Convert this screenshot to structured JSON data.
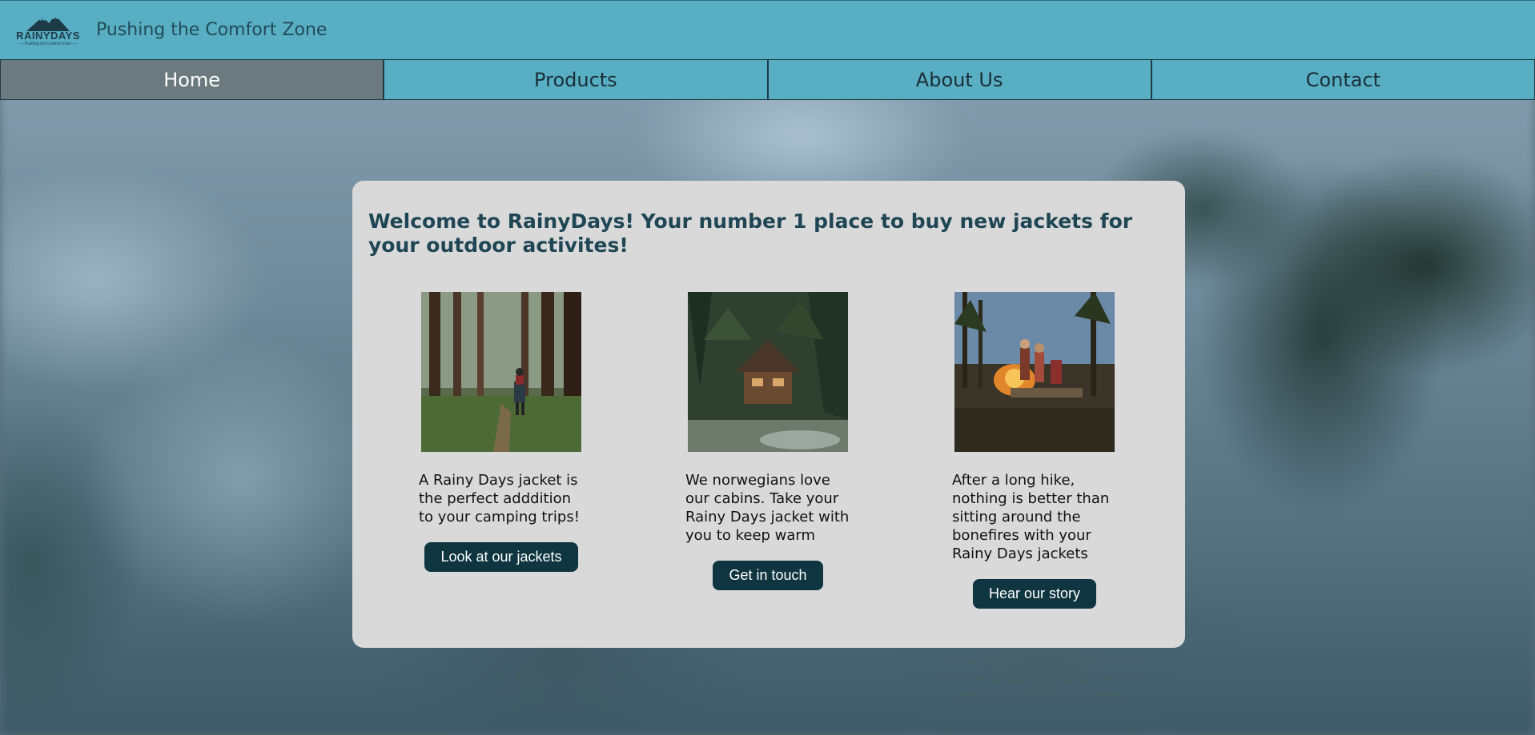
{
  "header": {
    "logo_text": "RAINYDAYS",
    "logo_subtext": "— Pushing the Comfort Zone —",
    "tagline": "Pushing the Comfort Zone"
  },
  "nav": {
    "items": [
      {
        "label": "Home",
        "active": true
      },
      {
        "label": "Products",
        "active": false
      },
      {
        "label": "About Us",
        "active": false
      },
      {
        "label": "Contact",
        "active": false
      }
    ]
  },
  "main": {
    "welcome": "Welcome to RainyDays! Your number 1 place to buy new jackets for your outdoor activites!",
    "cards": [
      {
        "image": "forest-hiker-photo",
        "text": "A Rainy Days jacket is the perfect adddition to your camping trips!",
        "button": "Look at our jackets"
      },
      {
        "image": "forest-cabin-photo",
        "text": "We norwegians love our cabins. Take your Rainy Days jacket with you to keep warm",
        "button": "Get in touch"
      },
      {
        "image": "campfire-photo",
        "text": "After a long hike, nothing is better than sitting around the bonefires with your Rainy Days jackets",
        "button": "Hear our story"
      }
    ]
  },
  "colors": {
    "header_bg": "#58aec3",
    "nav_active_bg": "#6b7a7e",
    "card_bg": "#d9d9d9",
    "button_bg": "#0e3540",
    "heading_color": "#1f4654"
  }
}
